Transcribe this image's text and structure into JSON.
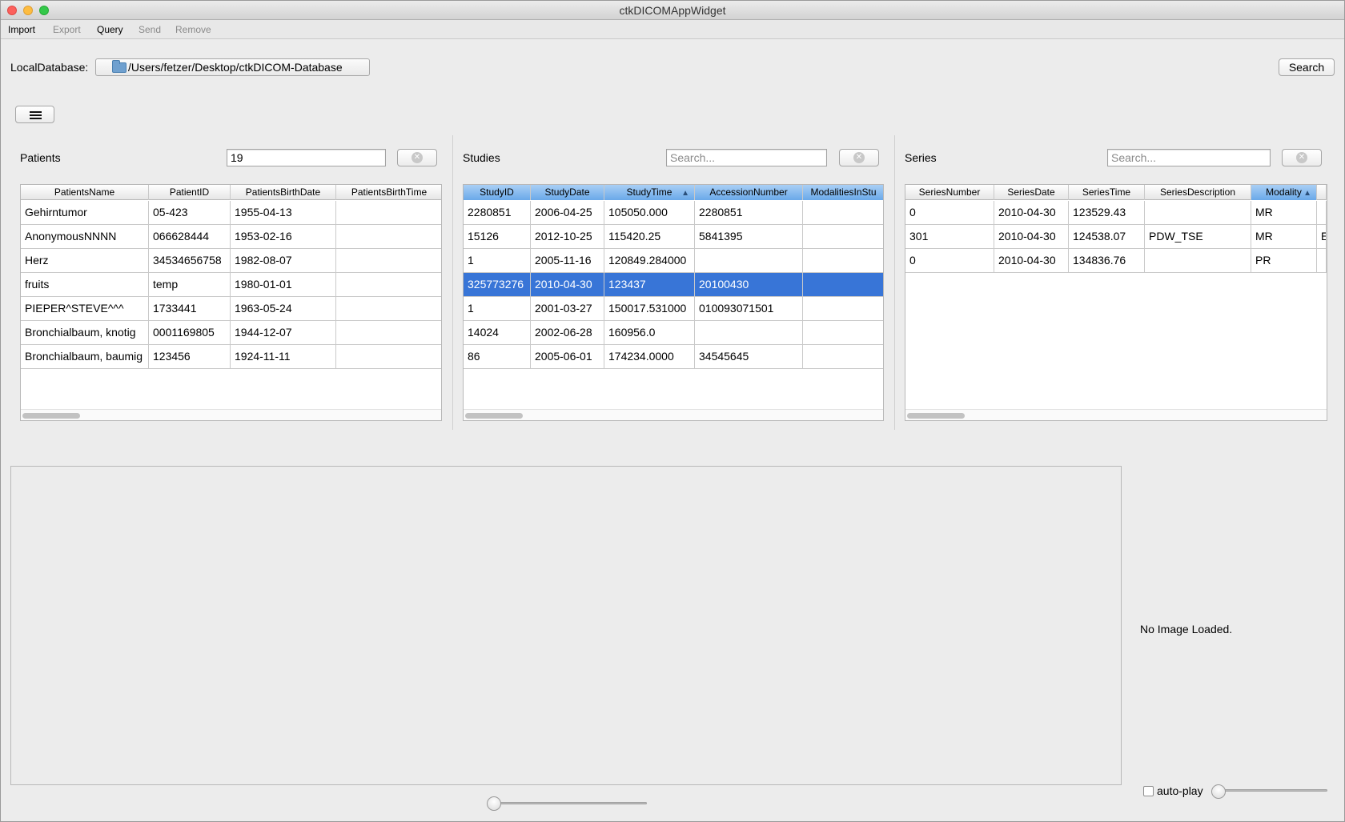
{
  "window": {
    "title": "ctkDICOMAppWidget"
  },
  "toolbar": {
    "import": "Import",
    "export": "Export",
    "query": "Query",
    "send": "Send",
    "remove": "Remove"
  },
  "local_db": {
    "label": "LocalDatabase:",
    "path": "/Users/fetzer/Desktop/ctkDICOM-Database",
    "search_button": "Search"
  },
  "patients": {
    "title": "Patients",
    "filter_value": "19",
    "columns": [
      "PatientsName",
      "PatientID",
      "PatientsBirthDate",
      "PatientsBirthTime"
    ],
    "rows": [
      [
        "Gehirntumor",
        "05-423",
        "1955-04-13",
        ""
      ],
      [
        "AnonymousNNNN",
        "066628444",
        "1953-02-16",
        ""
      ],
      [
        "Herz",
        "34534656758",
        "1982-08-07",
        ""
      ],
      [
        "fruits",
        "temp",
        "1980-01-01",
        ""
      ],
      [
        "PIEPER^STEVE^^^",
        "1733441",
        "1963-05-24",
        ""
      ],
      [
        "Bronchialbaum, knotig",
        "0001169805",
        "1944-12-07",
        ""
      ],
      [
        "Bronchialbaum, baumig",
        "123456",
        "1924-11-11",
        ""
      ]
    ]
  },
  "studies": {
    "title": "Studies",
    "search_placeholder": "Search...",
    "columns": [
      "StudyID",
      "StudyDate",
      "StudyTime",
      "AccessionNumber",
      "ModalitiesInStu"
    ],
    "sorted_column": "StudyTime",
    "rows": [
      [
        "2280851",
        "2006-04-25",
        "105050.000",
        "2280851",
        ""
      ],
      [
        "15126",
        "2012-10-25",
        "115420.25",
        "5841395",
        ""
      ],
      [
        "1",
        "2005-11-16",
        "120849.284000",
        "",
        ""
      ],
      [
        "325773276",
        "2010-04-30",
        "123437",
        "20100430",
        ""
      ],
      [
        "1",
        "2001-03-27",
        "150017.531000",
        "010093071501",
        ""
      ],
      [
        "14024",
        "2002-06-28",
        "160956.0",
        "",
        ""
      ],
      [
        "86",
        "2005-06-01",
        "174234.0000",
        "34545645",
        ""
      ]
    ],
    "selected_row": 3
  },
  "series": {
    "title": "Series",
    "search_placeholder": "Search...",
    "columns": [
      "SeriesNumber",
      "SeriesDate",
      "SeriesTime",
      "SeriesDescription",
      "Modality"
    ],
    "sorted_column": "Modality",
    "rows": [
      [
        "0",
        "2010-04-30",
        "123529.43",
        "",
        "MR"
      ],
      [
        "301",
        "2010-04-30",
        "124538.07",
        "PDW_TSE",
        "MR"
      ],
      [
        "0",
        "2010-04-30",
        "134836.76",
        "",
        "PR"
      ]
    ],
    "overflow_char": "E"
  },
  "viewer": {
    "status": "No Image Loaded.",
    "autoplay_label": "auto-play",
    "autoplay_checked": false
  },
  "colors": {
    "selection": "#3875d7",
    "header_selected": "#6aa9e9"
  }
}
